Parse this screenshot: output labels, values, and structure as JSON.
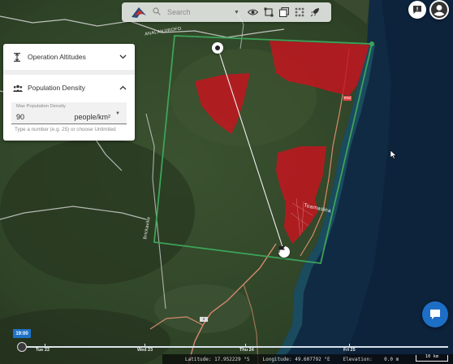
{
  "search": {
    "placeholder": "Search"
  },
  "panel": {
    "sections": [
      {
        "label": "Operation Altitudes",
        "expanded": false
      },
      {
        "label": "Population Density",
        "expanded": true
      }
    ],
    "population": {
      "field_label": "Max Population Density",
      "value": "90",
      "unit": "people/km²",
      "helper": "Type a number (e.g. 25) or choose Unlimited"
    }
  },
  "map_labels": {
    "road": "ANALANJIROFO",
    "city": "Toamasina",
    "district": "Brickaville",
    "route": "2",
    "route_b": "RN2"
  },
  "timeline": {
    "time_badge": "19:00",
    "days": [
      "Tue 22",
      "Wed 23",
      "Thu 24",
      "Fri 25"
    ]
  },
  "status": {
    "latitude": "Latitude: 17.952229 °S",
    "longitude": "Longitude: 49.607792 °E",
    "elevation": "Elevation:    0.0 m",
    "scale": "10 km"
  },
  "colors": {
    "zone_fill": "#c8141e",
    "area_stroke": "#3da35a",
    "accent": "#1e72c8"
  },
  "icons": [
    "logo-icon",
    "search-icon",
    "eye-icon",
    "area-select-icon",
    "layers-icon",
    "waypoints-icon",
    "rocket-icon",
    "feedback-icon",
    "account-icon",
    "altitude-icon",
    "population-icon",
    "chat-icon",
    "flag-icon"
  ]
}
